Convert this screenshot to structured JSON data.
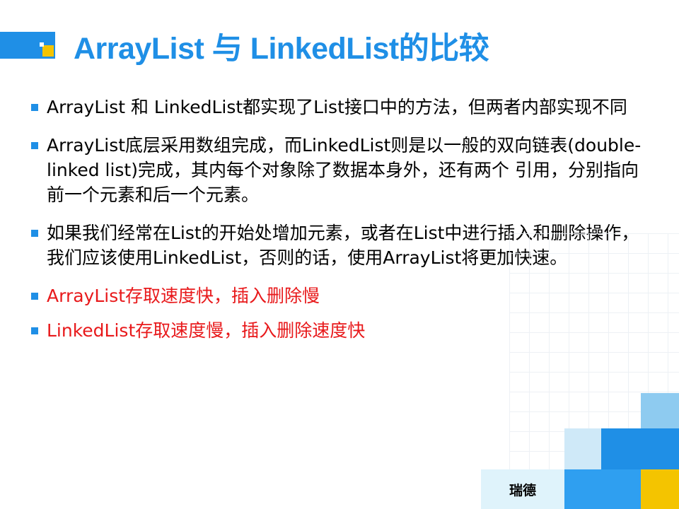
{
  "slide": {
    "title": "ArrayList 与 LinkedList的比较",
    "bullets": [
      {
        "text": "ArrayList 和 LinkedList都实现了List接口中的方法，但两者内部实现不同",
        "color": "#000000"
      },
      {
        "text": "ArrayList底层采用数组完成，而LinkedList则是以一般的双向链表(double-linked list)完成，其内每个对象除了数据本身外，还有两个 引用，分别指向前一个元素和后一个元素。",
        "color": "#000000"
      },
      {
        "text": "如果我们经常在List的开始处增加元素，或者在List中进行插入和删除操作，我们应该使用LinkedList，否则的话，使用ArrayList将更加快速。",
        "color": "#000000"
      },
      {
        "text": "ArrayList存取速度快，插入删除慢",
        "color": "#e8191b"
      },
      {
        "text": "LinkedList存取速度慢，插入删除速度快",
        "color": "#e8191b"
      }
    ],
    "footer": "瑞德"
  },
  "colors": {
    "accent_blue": "#1f8fe6",
    "accent_yellow": "#f4c400",
    "highlight_red": "#e8191b"
  }
}
